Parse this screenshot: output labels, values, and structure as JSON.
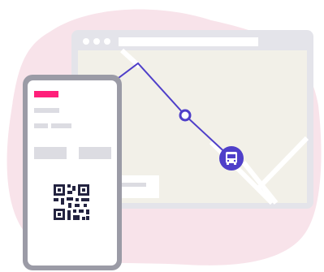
{
  "scene": {
    "description_colors": {
      "blob": "#f8e3ea",
      "browser_frame": "#e4e4ea",
      "map_bg": "#f2f0e8",
      "route": "#4f3fc9",
      "phone_frame": "#9b9ba6",
      "accent_bar": "#ff1f7a",
      "placeholder": "#dcdce2",
      "qr": "#232340"
    },
    "browser": {
      "dots": 3
    },
    "icons": {
      "waypoint": "waypoint-ring-icon",
      "bus": "bus-icon",
      "qr": "qr-code-icon"
    }
  }
}
